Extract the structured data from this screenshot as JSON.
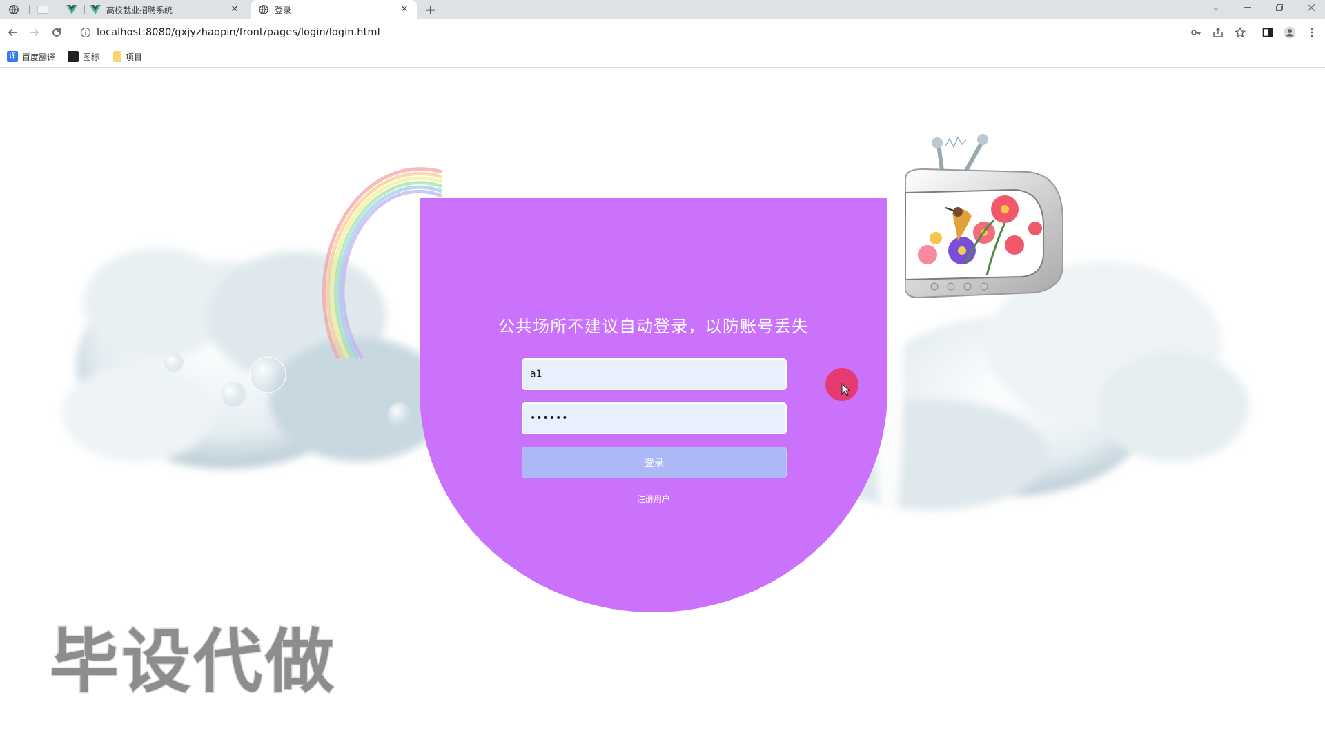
{
  "browser": {
    "tabs": [
      {
        "title": ""
      },
      {
        "title": ""
      },
      {
        "title": "高校就业招聘系统"
      },
      {
        "title": "登录"
      }
    ],
    "new_tab_label": "+",
    "url": "localhost:8080/gxjyzhaopin/front/pages/login/login.html",
    "bookmarks": [
      {
        "label": "百度翻译"
      },
      {
        "label": "图标"
      },
      {
        "label": "项目"
      }
    ]
  },
  "login": {
    "title": "公共场所不建议自动登录，以防账号丢失",
    "username_value": "a1",
    "password_value": "••••••",
    "login_button": "登录",
    "register_link": "注册用户"
  },
  "watermark": "毕设代做",
  "colors": {
    "card": "#ca72fb",
    "button": "#adb8f6",
    "cursor": "#e53b72"
  }
}
